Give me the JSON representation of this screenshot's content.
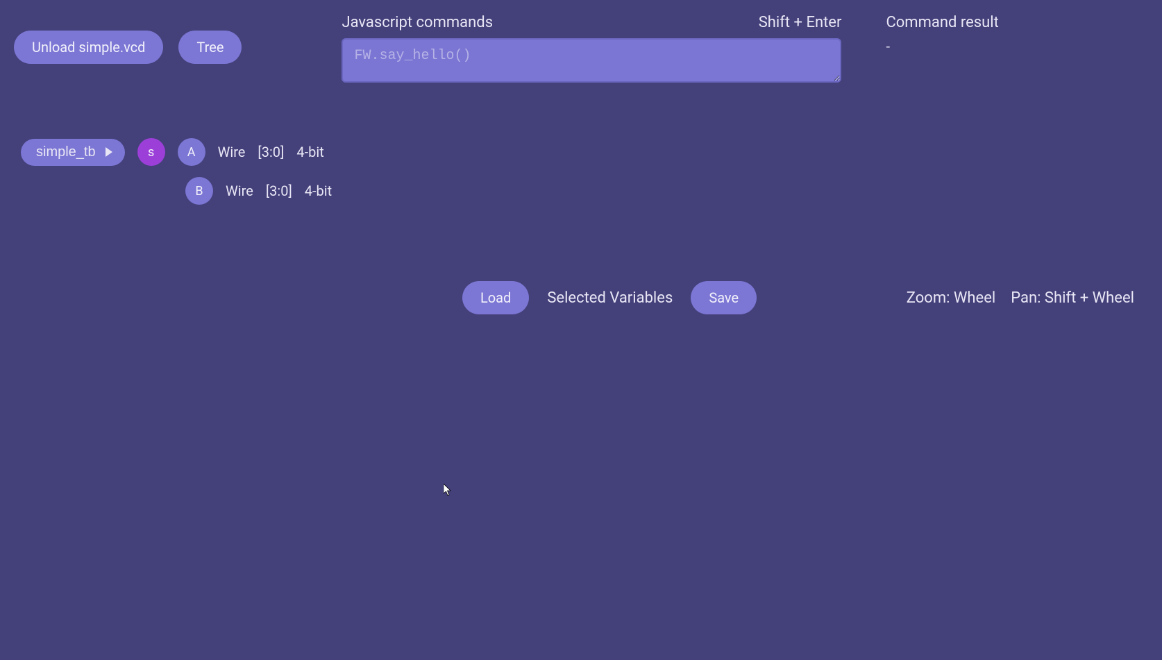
{
  "toolbar": {
    "unload_label": "Unload simple.vcd",
    "tree_label": "Tree"
  },
  "command": {
    "label": "Javascript commands",
    "shortcut": "Shift + Enter",
    "placeholder": "FW.say_hello()",
    "value": ""
  },
  "result": {
    "label": "Command result",
    "value": "-"
  },
  "scope": {
    "name": "simple_tb",
    "badge": "s"
  },
  "signals": [
    {
      "badge": "A",
      "type": "Wire",
      "range": "[3:0]",
      "width": "4-bit"
    },
    {
      "badge": "B",
      "type": "Wire",
      "range": "[3:0]",
      "width": "4-bit"
    }
  ],
  "actions": {
    "load_label": "Load",
    "selected_label": "Selected Variables",
    "save_label": "Save"
  },
  "hints": {
    "zoom": "Zoom: Wheel",
    "pan": "Pan: Shift + Wheel"
  }
}
